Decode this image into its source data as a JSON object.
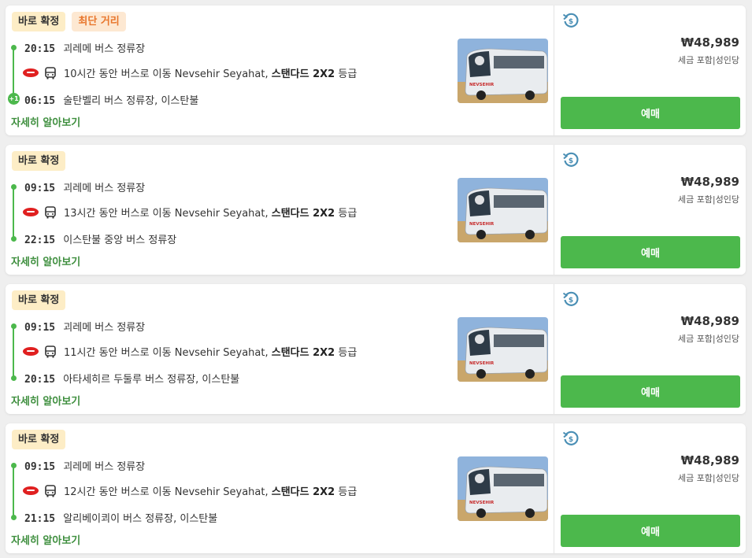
{
  "common": {
    "details_label": "자세히 알아보기",
    "book_label": "예매",
    "price": "₩48,989",
    "price_note": "세금 포함|성인당",
    "operator": "Nevsehir Seyahat,",
    "class_label": "스탠다드 2X2",
    "class_suffix": "등급",
    "bus_brand_text": "NEVSEHIR"
  },
  "badges": {
    "instant": "바로 확정",
    "shortest": "최단 거리"
  },
  "trips": [
    {
      "dep_time": "20:15",
      "dep_place": "괴레메 버스 정류장",
      "duration_text": "10시간 동안 버스로 이동",
      "arr_time": "06:15",
      "arr_place": "술탄벨리 버스 정류장, 이스탄불",
      "next_day": "+1"
    },
    {
      "dep_time": "09:15",
      "dep_place": "괴레메 버스 정류장",
      "duration_text": "13시간 동안 버스로 이동",
      "arr_time": "22:15",
      "arr_place": "이스탄불 중앙 버스 정류장"
    },
    {
      "dep_time": "09:15",
      "dep_place": "괴레메 버스 정류장",
      "duration_text": "11시간 동안 버스로 이동",
      "arr_time": "20:15",
      "arr_place": "아타세히르 두둘루 버스 정류장, 이스탄불"
    },
    {
      "dep_time": "09:15",
      "dep_place": "괴레메 버스 정류장",
      "duration_text": "12시간 동안 버스로 이동",
      "arr_time": "21:15",
      "arr_place": "알리베이쾨이 버스 정류장, 이스탄불"
    }
  ],
  "colors": {
    "accent_green": "#4cb84c",
    "details_green": "#3f8f3f",
    "refund_blue": "#4a8fb5",
    "shortest_orange": "#e8762c"
  }
}
